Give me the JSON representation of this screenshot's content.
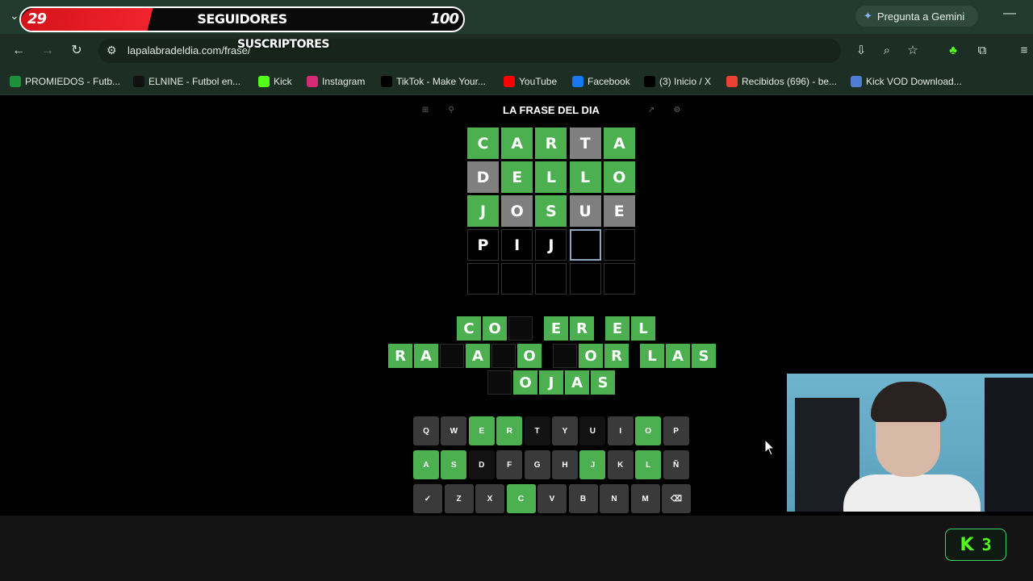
{
  "overlay": {
    "followers_current": "29",
    "followers_title": "SEGUIDORES",
    "followers_goal": "100",
    "followers_progress": 0.29,
    "subs_label": "SUSCRIPTORES"
  },
  "browser": {
    "gemini_label": "Pregunta a Gemini",
    "url": "lapalabradeldia.com/frase/",
    "bookmarks": [
      {
        "label": "PROMIEDOS - Futb...",
        "icon": "promiedos-icon",
        "color": "#1f8f3a"
      },
      {
        "label": "ELNINE - Futbol en...",
        "icon": "elnine-icon",
        "color": "#111111"
      },
      {
        "label": "Kick",
        "icon": "kick-icon",
        "color": "#53fc18"
      },
      {
        "label": "Instagram",
        "icon": "instagram-icon",
        "color": "#d62976"
      },
      {
        "label": "TikTok - Make Your...",
        "icon": "tiktok-icon",
        "color": "#000000"
      },
      {
        "label": "YouTube",
        "icon": "youtube-icon",
        "color": "#ff0000"
      },
      {
        "label": "Facebook",
        "icon": "facebook-icon",
        "color": "#1877f2"
      },
      {
        "label": "(3) Inicio / X",
        "icon": "x-icon",
        "color": "#000000"
      },
      {
        "label": "Recibidos (696) - be...",
        "icon": "gmail-icon",
        "color": "#ea4335"
      },
      {
        "label": "Kick VOD Download...",
        "icon": "kickvod-icon",
        "color": "#4f7dd1"
      }
    ]
  },
  "game": {
    "title": "LA FRASE DEL DIA",
    "grid": [
      [
        {
          "l": "C",
          "s": "green"
        },
        {
          "l": "A",
          "s": "green"
        },
        {
          "l": "R",
          "s": "green"
        },
        {
          "l": "T",
          "s": "gray"
        },
        {
          "l": "A",
          "s": "green"
        }
      ],
      [
        {
          "l": "D",
          "s": "gray"
        },
        {
          "l": "E",
          "s": "green"
        },
        {
          "l": "L",
          "s": "green"
        },
        {
          "l": "L",
          "s": "green"
        },
        {
          "l": "O",
          "s": "green"
        }
      ],
      [
        {
          "l": "J",
          "s": "green"
        },
        {
          "l": "O",
          "s": "gray"
        },
        {
          "l": "S",
          "s": "green"
        },
        {
          "l": "U",
          "s": "gray"
        },
        {
          "l": "E",
          "s": "gray"
        }
      ],
      [
        {
          "l": "P",
          "s": "typed"
        },
        {
          "l": "I",
          "s": "typed"
        },
        {
          "l": "J",
          "s": "typed"
        },
        {
          "l": "",
          "s": "active"
        },
        {
          "l": "",
          "s": "empty"
        }
      ],
      [
        {
          "l": "",
          "s": "empty"
        },
        {
          "l": "",
          "s": "empty"
        },
        {
          "l": "",
          "s": "empty"
        },
        {
          "l": "",
          "s": "empty"
        },
        {
          "l": "",
          "s": "empty"
        }
      ]
    ],
    "phrase_rows": [
      [
        {
          "l": "C",
          "s": "green"
        },
        {
          "l": "O",
          "s": "green"
        },
        {
          "l": "",
          "s": "dark"
        },
        {
          "gap": true
        },
        {
          "l": "E",
          "s": "green"
        },
        {
          "l": "R",
          "s": "green"
        },
        {
          "gap": true
        },
        {
          "l": "E",
          "s": "green"
        },
        {
          "l": "L",
          "s": "green"
        }
      ],
      [
        {
          "l": "R",
          "s": "green"
        },
        {
          "l": "A",
          "s": "green"
        },
        {
          "l": "",
          "s": "dark"
        },
        {
          "l": "A",
          "s": "green"
        },
        {
          "l": "",
          "s": "dark"
        },
        {
          "l": "O",
          "s": "green"
        },
        {
          "gap": true
        },
        {
          "l": "",
          "s": "dark"
        },
        {
          "l": "O",
          "s": "green"
        },
        {
          "l": "R",
          "s": "green"
        },
        {
          "gap": true
        },
        {
          "l": "L",
          "s": "green"
        },
        {
          "l": "A",
          "s": "green"
        },
        {
          "l": "S",
          "s": "green"
        }
      ],
      [
        {
          "l": "",
          "s": "dark"
        },
        {
          "l": "O",
          "s": "green"
        },
        {
          "l": "J",
          "s": "green"
        },
        {
          "l": "A",
          "s": "green"
        },
        {
          "l": "S",
          "s": "green"
        }
      ]
    ],
    "keyboard": [
      [
        {
          "k": "Q",
          "s": "gray"
        },
        {
          "k": "W",
          "s": "gray"
        },
        {
          "k": "E",
          "s": "green"
        },
        {
          "k": "R",
          "s": "green"
        },
        {
          "k": "T",
          "s": "dark"
        },
        {
          "k": "Y",
          "s": "gray"
        },
        {
          "k": "U",
          "s": "dark"
        },
        {
          "k": "I",
          "s": "gray"
        },
        {
          "k": "O",
          "s": "green"
        },
        {
          "k": "P",
          "s": "gray"
        }
      ],
      [
        {
          "k": "A",
          "s": "green"
        },
        {
          "k": "S",
          "s": "green"
        },
        {
          "k": "D",
          "s": "dark"
        },
        {
          "k": "F",
          "s": "gray"
        },
        {
          "k": "G",
          "s": "gray"
        },
        {
          "k": "H",
          "s": "gray"
        },
        {
          "k": "J",
          "s": "green"
        },
        {
          "k": "K",
          "s": "gray"
        },
        {
          "k": "L",
          "s": "green"
        },
        {
          "k": "Ñ",
          "s": "gray"
        }
      ],
      [
        {
          "k": "✓",
          "s": "gray"
        },
        {
          "k": "Z",
          "s": "gray"
        },
        {
          "k": "X",
          "s": "gray"
        },
        {
          "k": "C",
          "s": "green"
        },
        {
          "k": "V",
          "s": "gray"
        },
        {
          "k": "B",
          "s": "gray"
        },
        {
          "k": "N",
          "s": "gray"
        },
        {
          "k": "M",
          "s": "gray"
        },
        {
          "k": "⌫",
          "s": "gray"
        }
      ]
    ]
  },
  "kick_badge": {
    "count": "3"
  }
}
